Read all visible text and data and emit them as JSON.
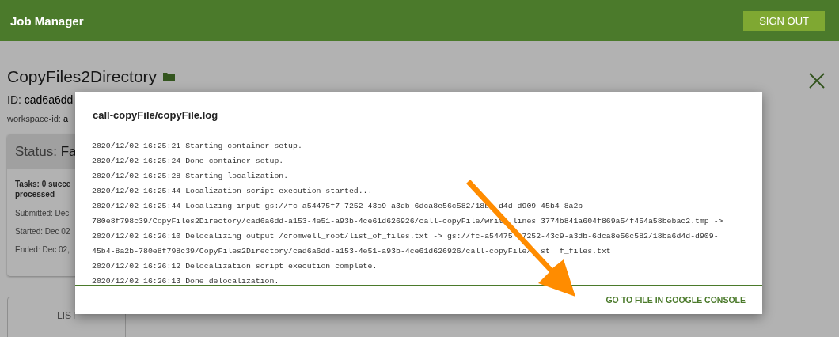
{
  "header": {
    "title": "Job Manager",
    "sign_out": "SIGN OUT"
  },
  "job": {
    "name": "CopyFiles2Directory",
    "id_label": "ID:",
    "id_value": "cad6a6dd",
    "workspace_label": "workspace-id:",
    "workspace_value": "a"
  },
  "status_card": {
    "label": "Status:",
    "value": "Fa",
    "tasks": "Tasks: 0 succe",
    "tasks_line2": "processed",
    "submitted": "Submitted: Dec",
    "started": "Started: Dec 02",
    "ended": "Ended: Dec 02,"
  },
  "tabs": [
    {
      "label": "LIST",
      "selected": false
    }
  ],
  "modal": {
    "title": "call-copyFile/copyFile.log",
    "log_lines": [
      [
        "2020/12/02 16:25:21 Starting container setup."
      ],
      [
        "2020/12/02 16:25:24 Done container setup."
      ],
      [
        "2020/12/02 16:25:28 Starting localization."
      ],
      [
        "2020/12/02 16:25:44 Localization script execution started..."
      ],
      [
        "2020/12/02 16:25:44 Localizing input gs://fc-a54475f7-7252-43c9-a3db-6dca8e56c582/18b",
        "d4d-d909-45b4-8a2b-"
      ],
      [
        "780e8f798c39/CopyFiles2Directory/cad6a6dd-a153-4e51-a93b-4ce61d626926/call-copyFile/writ",
        "lines 3774b841a604f869a54f454a58bebac2.tmp ->"
      ],
      [
        "2020/12/02 16:26:10 Delocalizing output /cromwell_root/list_of_files.txt -> gs://fc-a54475",
        "7252-43c9-a3db-6dca8e56c582/18ba6d4d-d909-"
      ],
      [
        "45b4-8a2b-780e8f798c39/CopyFiles2Directory/cad6a6dd-a153-4e51-a93b-4ce61d626926/call-copyFile/",
        "st",
        "f_files.txt"
      ],
      [
        "2020/12/02 16:26:12 Delocalization script execution complete."
      ],
      [
        "2020/12/02 16:26:13 Done delocalization."
      ]
    ],
    "link": "GO TO FILE IN GOOGLE CONSOLE"
  }
}
